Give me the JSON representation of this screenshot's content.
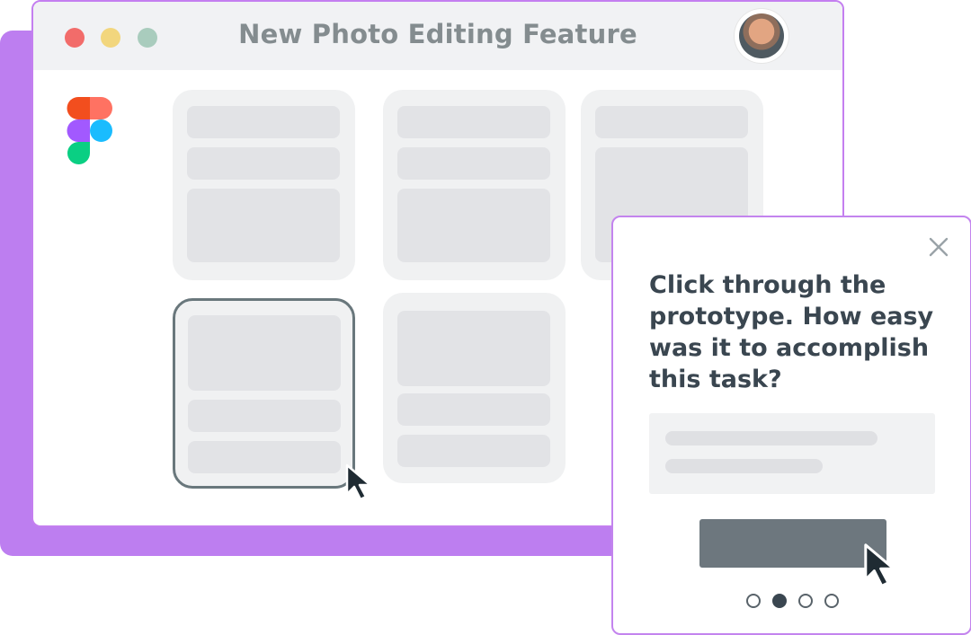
{
  "window": {
    "title": "New Photo Editing Feature",
    "traffic_lights": [
      "close",
      "minimize",
      "zoom"
    ]
  },
  "avatar": {
    "icon": "user-avatar"
  },
  "logo": {
    "icon": "figma-logo"
  },
  "grid": {
    "cards": 5,
    "selected_card": 4
  },
  "survey": {
    "question": "Click through the prototype. How easy was it to accomplish this task?",
    "close_icon": "close-icon",
    "submit_label": "",
    "pager": {
      "total": 4,
      "current": 2
    }
  },
  "colors": {
    "accent_purple": "#bd7ef0",
    "text_dark": "#3a4650",
    "button_gray": "#6d777e"
  }
}
